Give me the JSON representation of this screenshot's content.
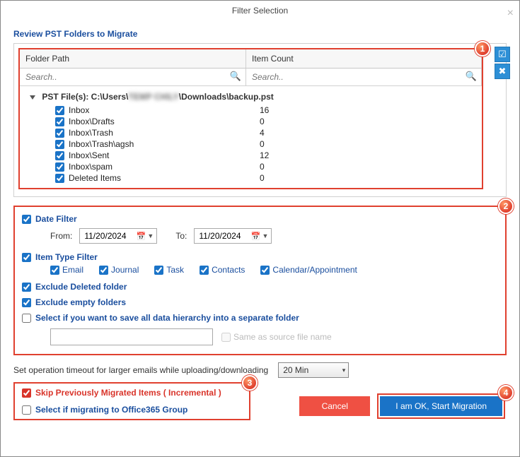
{
  "window": {
    "title": "Filter Selection"
  },
  "review": {
    "heading": "Review PST Folders to Migrate",
    "col_path": "Folder Path",
    "col_count": "Item Count",
    "search_placeholder_path": "Search..",
    "search_placeholder_count": "Search..",
    "root_prefix": "PST File(s): C:\\Users\\",
    "root_blur": "TEMP CHILY",
    "root_suffix": "\\Downloads\\backup.pst",
    "rows": [
      {
        "label": "Inbox",
        "count": "16"
      },
      {
        "label": "Inbox\\Drafts",
        "count": "0"
      },
      {
        "label": "Inbox\\Trash",
        "count": "4"
      },
      {
        "label": "Inbox\\Trash\\agsh",
        "count": "0"
      },
      {
        "label": "Inbox\\Sent",
        "count": "12"
      },
      {
        "label": "Inbox\\spam",
        "count": "0"
      },
      {
        "label": "Deleted Items",
        "count": "0"
      }
    ]
  },
  "dateFilter": {
    "title": "Date Filter",
    "from_label": "From:",
    "to_label": "To:",
    "from": "11/20/2024",
    "to": "11/20/2024"
  },
  "itemType": {
    "title": "Item Type Filter",
    "email": "Email",
    "journal": "Journal",
    "task": "Task",
    "contacts": "Contacts",
    "calendar": "Calendar/Appointment"
  },
  "options": {
    "exclude_deleted": "Exclude Deleted folder",
    "exclude_empty": "Exclude empty folders",
    "save_separate": "Select if you want to save all data hierarchy into a separate folder",
    "same_as_source": "Same as source file name"
  },
  "timeout": {
    "label": "Set operation timeout for larger emails while uploading/downloading",
    "value": "20 Min"
  },
  "incremental": {
    "skip": "Skip Previously Migrated Items ( Incremental )",
    "o365": "Select if migrating to Office365 Group"
  },
  "buttons": {
    "cancel": "Cancel",
    "start": "I am OK, Start Migration"
  },
  "callouts": {
    "c1": "1",
    "c2": "2",
    "c3": "3",
    "c4": "4"
  }
}
